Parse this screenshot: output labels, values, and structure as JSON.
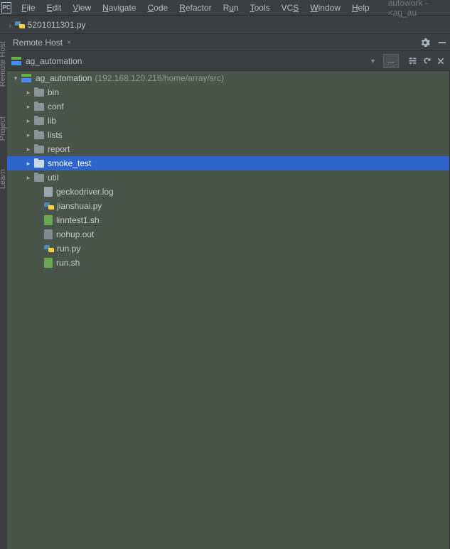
{
  "logo_text": "PC",
  "menubar": [
    {
      "label": "File",
      "u": 0
    },
    {
      "label": "Edit",
      "u": 0
    },
    {
      "label": "View",
      "u": 0
    },
    {
      "label": "Navigate",
      "u": 0
    },
    {
      "label": "Code",
      "u": 0
    },
    {
      "label": "Refactor",
      "u": 0
    },
    {
      "label": "Run",
      "u": 1
    },
    {
      "label": "Tools",
      "u": 0
    },
    {
      "label": "VCS",
      "u": 2
    },
    {
      "label": "Window",
      "u": 0
    },
    {
      "label": "Help",
      "u": 0
    }
  ],
  "window_title": "autowork - <ag_au",
  "breadcrumb": {
    "file": "5201011301.py"
  },
  "panel": {
    "title": "Remote Host"
  },
  "host_selector": {
    "name": "ag_automation",
    "browse": "..."
  },
  "left_rail": {
    "remote_host": "Remote Host",
    "project": "Project",
    "learn": "Learn"
  },
  "tree": {
    "root": {
      "name": "ag_automation",
      "info": "(192.168.120.216/home/array/src)"
    },
    "folders": [
      {
        "name": "bin"
      },
      {
        "name": "conf"
      },
      {
        "name": "lib"
      },
      {
        "name": "lists"
      },
      {
        "name": "report"
      },
      {
        "name": "smoke_test",
        "selected": true
      },
      {
        "name": "util"
      }
    ],
    "files": [
      {
        "name": "geckodriver.log",
        "kind": "log"
      },
      {
        "name": "jianshuai.py",
        "kind": "py"
      },
      {
        "name": "linntest1.sh",
        "kind": "sh"
      },
      {
        "name": "nohup.out",
        "kind": "out"
      },
      {
        "name": "run.py",
        "kind": "py"
      },
      {
        "name": "run.sh",
        "kind": "sh"
      }
    ]
  }
}
